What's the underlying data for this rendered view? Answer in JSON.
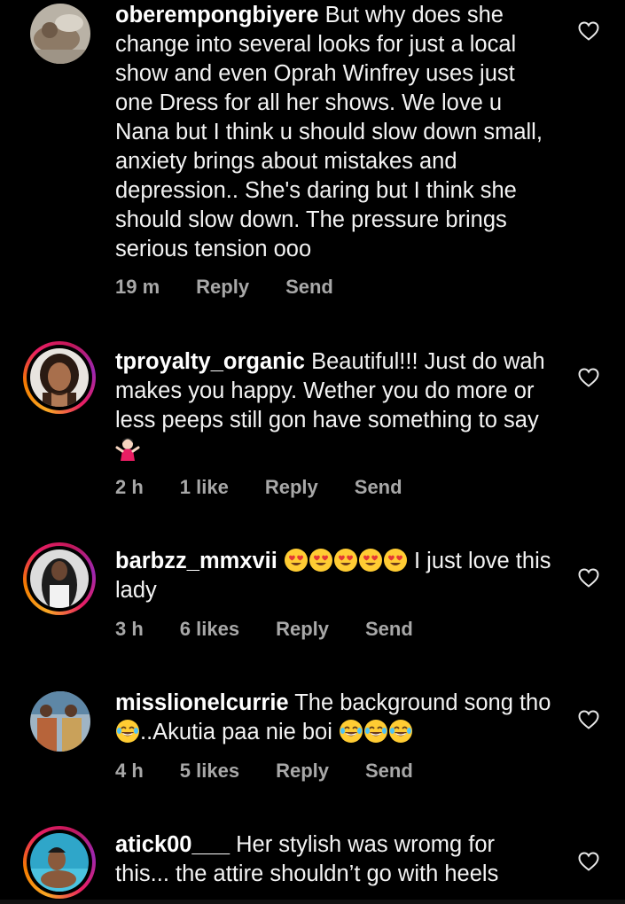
{
  "comments": [
    {
      "username": "oberempongbiyere",
      "text": " But why does she change into several looks for just a local show and even Oprah Winfrey uses just one Dress for all her shows. We love u Nana but I think u should slow down small, anxiety brings about mistakes and depression.. She's daring but I think she should slow down. The pressure brings serious tension ooo",
      "time": "19 m",
      "likes": "",
      "reply": "Reply",
      "send": "Send"
    },
    {
      "username": "tproyalty_organic",
      "text": " Beautiful!!! Just do wah makes you happy. Wether you do more or less peeps still gon have something to say",
      "time": "2 h",
      "likes": "1 like",
      "reply": "Reply",
      "send": "Send"
    },
    {
      "username": "barbzz_mmxvii",
      "text": " I just love this lady",
      "time": "3 h",
      "likes": "6 likes",
      "reply": "Reply",
      "send": "Send"
    },
    {
      "username": "misslionelcurrie",
      "text": " The background song tho ",
      "text2": "..Akutia paa nie boi ",
      "time": "4 h",
      "likes": "5 likes",
      "reply": "Reply",
      "send": "Send"
    },
    {
      "username": "atick00___",
      "text": " Her stylish was wromg for this... the attire shouldn’t go with heels",
      "time": "",
      "likes": "",
      "reply": "",
      "send": ""
    }
  ],
  "icons": {
    "like": "heart-outline-icon",
    "emoji_shrug": "woman-shrugging-emoji",
    "emoji_love": "heart-eyes-emoji",
    "emoji_laugh": "tears-of-joy-emoji"
  },
  "colors": {
    "background": "#000000",
    "text": "#f3f3f3",
    "meta": "#a8a8a8"
  }
}
